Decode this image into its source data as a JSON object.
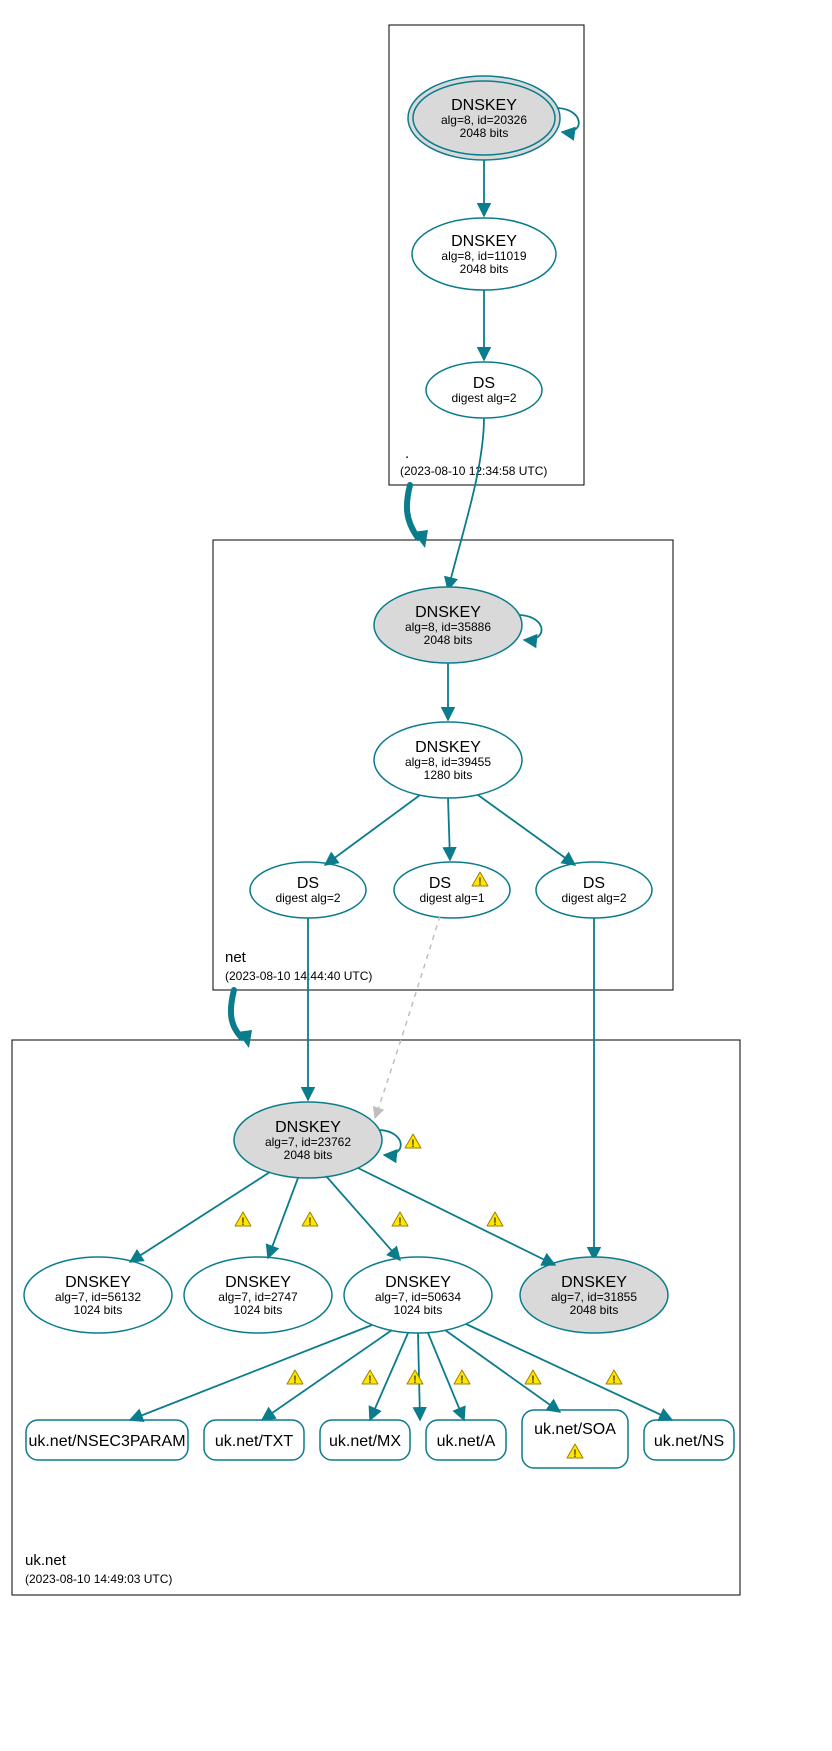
{
  "zones": {
    "root": {
      "label": ".",
      "timestamp": "(2023-08-10 12:34:58 UTC)"
    },
    "net": {
      "label": "net",
      "timestamp": "(2023-08-10 14:44:40 UTC)"
    },
    "uknet": {
      "label": "uk.net",
      "timestamp": "(2023-08-10 14:49:03 UTC)"
    }
  },
  "nodes": {
    "root_ksk": {
      "t": "DNSKEY",
      "l2": "alg=8, id=20326",
      "l3": "2048 bits"
    },
    "root_zsk": {
      "t": "DNSKEY",
      "l2": "alg=8, id=11019",
      "l3": "2048 bits"
    },
    "root_ds": {
      "t": "DS",
      "l2": "digest alg=2"
    },
    "net_ksk": {
      "t": "DNSKEY",
      "l2": "alg=8, id=35886",
      "l3": "2048 bits"
    },
    "net_zsk": {
      "t": "DNSKEY",
      "l2": "alg=8, id=39455",
      "l3": "1280 bits"
    },
    "net_ds_a": {
      "t": "DS",
      "l2": "digest alg=2"
    },
    "net_ds_b": {
      "t": "DS",
      "l2": "digest alg=1"
    },
    "net_ds_c": {
      "t": "DS",
      "l2": "digest alg=2"
    },
    "uk_ksk": {
      "t": "DNSKEY",
      "l2": "alg=7, id=23762",
      "l3": "2048 bits"
    },
    "uk_zsk1": {
      "t": "DNSKEY",
      "l2": "alg=7, id=56132",
      "l3": "1024 bits"
    },
    "uk_zsk2": {
      "t": "DNSKEY",
      "l2": "alg=7, id=2747",
      "l3": "1024 bits"
    },
    "uk_zsk3": {
      "t": "DNSKEY",
      "l2": "alg=7, id=50634",
      "l3": "1024 bits"
    },
    "uk_key31855": {
      "t": "DNSKEY",
      "l2": "alg=7, id=31855",
      "l3": "2048 bits"
    },
    "rr_nsec3": {
      "t": "uk.net/NSEC3PARAM"
    },
    "rr_txt": {
      "t": "uk.net/TXT"
    },
    "rr_mx": {
      "t": "uk.net/MX"
    },
    "rr_a": {
      "t": "uk.net/A"
    },
    "rr_soa": {
      "t": "uk.net/SOA"
    },
    "rr_ns": {
      "t": "uk.net/NS"
    }
  }
}
